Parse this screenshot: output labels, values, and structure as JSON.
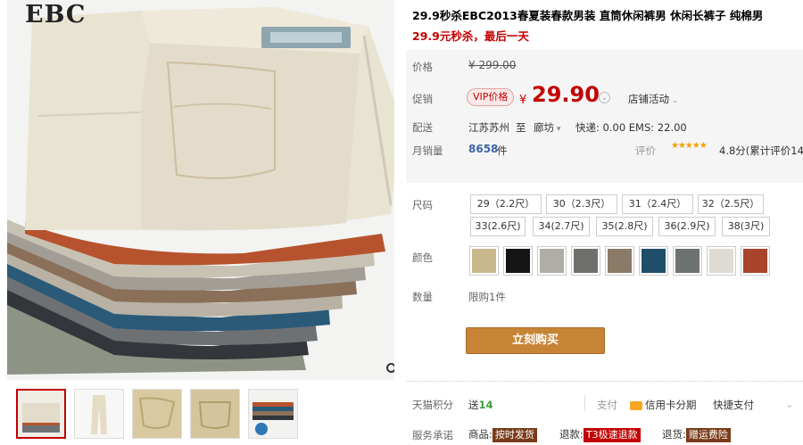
{
  "brand": "EBC",
  "title": "29.9秒杀EBC2013春夏装春款男装 直筒休闲裤男 休闲长裤子 纯棉男",
  "subtitle": "29.9元秒杀，最后一天",
  "price": {
    "label": "价格",
    "original": "¥ 299.00"
  },
  "promo": {
    "label": "促销",
    "vip": "VIP价格",
    "currency": "¥",
    "value": "29.90",
    "store": "店铺活动"
  },
  "delivery": {
    "label": "配送",
    "from": "江苏苏州",
    "to_word": "至",
    "to": "廊坊",
    "express": "快递: 0.00 EMS: 22.00"
  },
  "sales": {
    "label": "月销量",
    "count": "8658",
    "unit": "件",
    "rating_label": "评价",
    "stars": "★★★★★",
    "rating": "4.8分(累计评价14"
  },
  "size": {
    "label": "尺码",
    "options": [
      "29（2.2尺）",
      "30（2.3尺）",
      "31（2.4尺）",
      "32（2.5尺）",
      "33(2.6尺)",
      "34(2.7尺)",
      "35(2.8尺)",
      "36(2.9尺)",
      "38(3尺)"
    ]
  },
  "color": {
    "label": "颜色",
    "swatches": [
      "#c9b88c",
      "#151515",
      "#b0aca6",
      "#6f706c",
      "#8c7a68",
      "#1f4e6a",
      "#6d736f",
      "#e0dbd2",
      "#a8442c"
    ]
  },
  "quantity": {
    "label": "数量",
    "limit": "限购1件"
  },
  "buy_label": "立刻购买",
  "bottom": {
    "points_label": "天猫积分",
    "points_prefix": "送",
    "points_value": "14",
    "pay_label": "支付",
    "credit": "信用卡分期",
    "quick": "快捷支付",
    "service_label": "服务承诺",
    "goods": "商品:",
    "goods_tag": "按时发货",
    "refund": "退款:",
    "refund_tag": "T3极速退款",
    "return": "退货:",
    "return_tag": "赠运费险"
  }
}
